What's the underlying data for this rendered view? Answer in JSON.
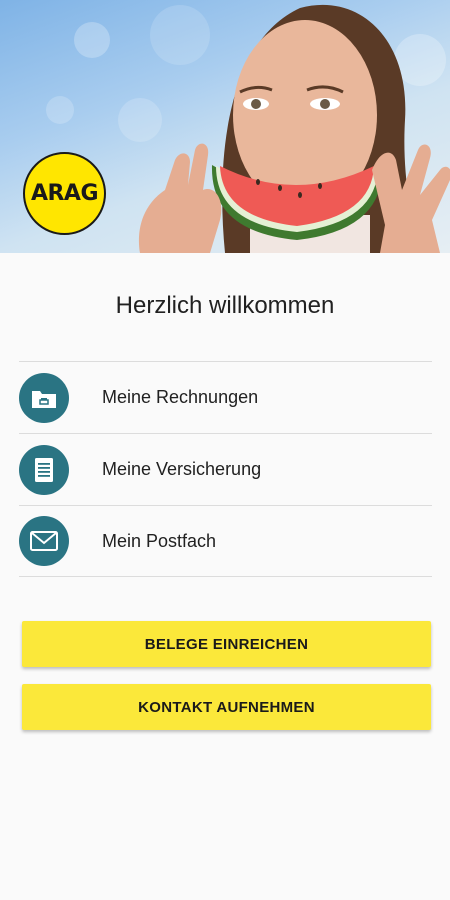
{
  "header": {
    "logo_text": "ARAG"
  },
  "welcome_title": "Herzlich willkommen",
  "menu": {
    "items": [
      {
        "label": "Meine Rechnungen",
        "icon": "folder-icon"
      },
      {
        "label": "Meine Versicherung",
        "icon": "document-icon"
      },
      {
        "label": "Mein Postfach",
        "icon": "mail-icon"
      }
    ]
  },
  "actions": {
    "submit_receipts_label": "BELEGE EINREICHEN",
    "contact_label": "KONTAKT AUFNEHMEN"
  },
  "colors": {
    "icon_background": "#2a7483",
    "button_background": "#fbe83a",
    "logo_yellow": "#ffe600"
  }
}
